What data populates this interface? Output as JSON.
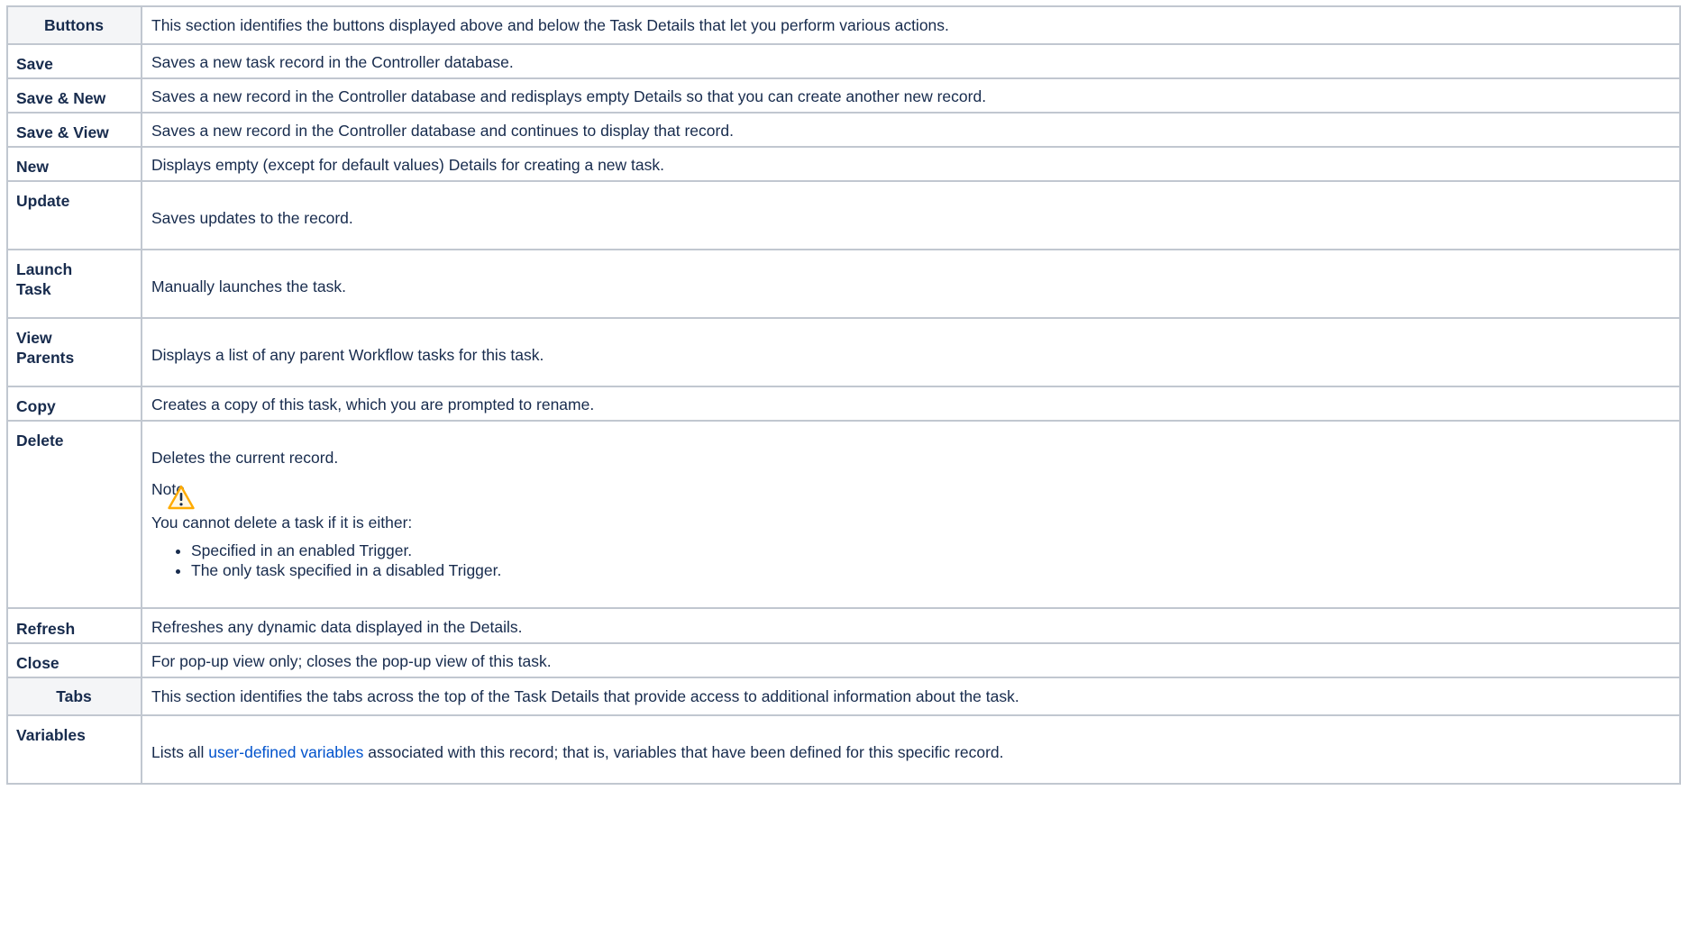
{
  "buttons_header": {
    "label": "Buttons",
    "description": "This section identifies the buttons displayed above and below the Task Details that let you perform various actions."
  },
  "buttons": [
    {
      "label": "Save",
      "description": "Saves a new task record in the Controller database."
    },
    {
      "label": "Save & New",
      "description": "Saves a new record in the Controller database and redisplays empty Details so that you can create another new record."
    },
    {
      "label": "Save & View",
      "description": "Saves a new record in the Controller database and continues to display that record."
    },
    {
      "label": "New",
      "description": "Displays empty (except for default values) Details for creating a new task."
    },
    {
      "label": "Update",
      "description": "Saves updates to the record."
    },
    {
      "label_line1": "Launch",
      "label_line2": "Task",
      "description": "Manually launches the task."
    },
    {
      "label_line1": "View",
      "label_line2": "Parents",
      "description": "Displays a list of any parent Workflow tasks for this task."
    },
    {
      "label": "Copy",
      "description": "Creates a copy of this task, which you are prompted to rename."
    },
    {
      "label": "Delete",
      "description": "Deletes the current record.",
      "note_title": "Note",
      "note_text": "You cannot delete a task if it is either:",
      "note_items": [
        "Specified in an enabled Trigger.",
        "The only task specified in a disabled Trigger."
      ]
    },
    {
      "label": "Refresh",
      "description": "Refreshes any dynamic data displayed in the Details."
    },
    {
      "label": "Close",
      "description": "For pop-up view only; closes the pop-up view of this task."
    }
  ],
  "tabs_header": {
    "label": "Tabs",
    "description": "This section identifies the tabs across the top of the Task Details that provide access to additional information about the task."
  },
  "tabs": [
    {
      "label": "Variables",
      "description_prefix": "Lists all ",
      "link_text": "user-defined variables",
      "description_suffix": " associated with this record; that is, variables that have been defined for this specific record."
    }
  ],
  "colors": {
    "border": "#c1c7d0",
    "header_bg": "#f4f5f7",
    "link": "#0052cc",
    "warning": "#ffab00"
  },
  "icons": {
    "note_icon": "warning-icon"
  }
}
